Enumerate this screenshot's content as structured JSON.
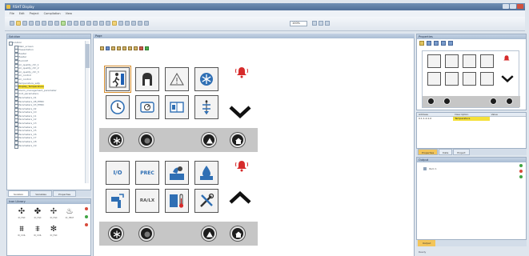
{
  "window": {
    "title": "RSHT Display"
  },
  "menu": [
    "File",
    "Edit",
    "Project",
    "Compilation",
    "View"
  ],
  "toolbar": {
    "zoom": "100%"
  },
  "left_panel": {
    "title": "Solution",
    "tree": [
      {
        "label": "Solution",
        "root": true
      },
      {
        "label": "Main_screen"
      },
      {
        "label": "Presentation"
      },
      {
        "label": "Heater"
      },
      {
        "label": "Heater"
      },
      {
        "label": "Humidif"
      },
      {
        "label": "Air_quality_ctrl_1"
      },
      {
        "label": "Air_quality_ctrl_2"
      },
      {
        "label": "Air_quality_ctrl_3"
      },
      {
        "label": "Air_control"
      },
      {
        "label": "Air_control"
      },
      {
        "label": "Temperature_setp"
      },
      {
        "label": "Display_Temperature",
        "selected": true
      },
      {
        "label": "Alarm_management_parameter"
      },
      {
        "label": "Unit_parameters"
      },
      {
        "label": "Parameters_01"
      },
      {
        "label": "Parameters_08_EHRC"
      },
      {
        "label": "Parameters_03_EHRC"
      },
      {
        "label": "Parameters_02"
      },
      {
        "label": "Parameters_10"
      },
      {
        "label": "Parameters_11"
      },
      {
        "label": "Parameters_12"
      },
      {
        "label": "Parameters_13"
      },
      {
        "label": "Parameters_14"
      },
      {
        "label": "Parameters_15"
      },
      {
        "label": "Parameters_16"
      },
      {
        "label": "Parameters_17"
      },
      {
        "label": "Parameters_18"
      },
      {
        "label": "Parameters_19"
      }
    ],
    "tabs": [
      "Solution",
      "Variables",
      "Properties"
    ]
  },
  "icon_library": {
    "title": "Icon Library"
  },
  "document": {
    "tab_label": "Page"
  },
  "device": {
    "top_tiles": [
      "emergency-exit",
      "occupancy",
      "alarm-triangle",
      "snowflake",
      "clock",
      "fan",
      "boiler",
      "heat-exchanger"
    ],
    "bottom_tiles": [
      {
        "name": "io-tile",
        "text": "I/O"
      },
      {
        "name": "prec-tile",
        "text": "PREC"
      },
      {
        "name": "fan-tile",
        "text": ""
      },
      {
        "name": "water-tile",
        "text": ""
      },
      {
        "name": "valve-tile",
        "text": ""
      },
      {
        "name": "ranalyzer-tile",
        "text": "RA/LX"
      },
      {
        "name": "thermometer-tile",
        "text": ""
      },
      {
        "name": "tools-tile",
        "text": ""
      }
    ]
  },
  "properties_panel": {
    "title": "Properties"
  },
  "table_panel": {
    "headers": [
      "Address",
      "Description",
      "Value"
    ],
    "row": {
      "address": "0.1.1.0.1.0",
      "description": "",
      "value": "Temperature"
    }
  },
  "right_tabs": [
    "Properties",
    "Data",
    "Project"
  ],
  "output": {
    "title": "Output",
    "line": "Item 1",
    "tab": "Output"
  },
  "status": {
    "text": "Ready"
  },
  "colors": {
    "accent_alarm": "#d62b2b",
    "nav_strip": "#c6c6c6",
    "selection": "#f5e03a",
    "chrome": "#dfe6ee"
  }
}
